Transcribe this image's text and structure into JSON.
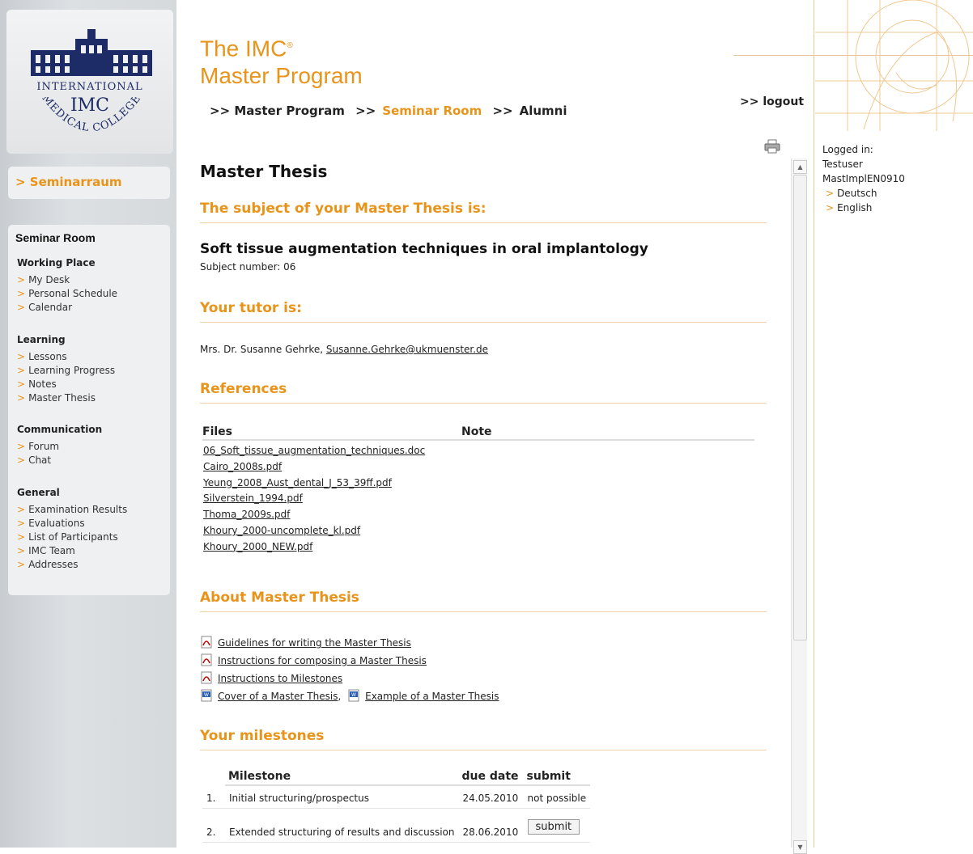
{
  "logo": {
    "line1": "INTERNATIONAL",
    "line2": "IMC",
    "line3": "MEDICAL COLLEGE"
  },
  "sidebar": {
    "section_link": "> Seminarraum",
    "menu_title": "Seminar Room",
    "groups": [
      {
        "title": "Working Place",
        "items": [
          "My Desk",
          "Personal Schedule",
          "Calendar"
        ]
      },
      {
        "title": "Learning",
        "items": [
          "Lessons",
          "Learning Progress",
          "Notes",
          "Master Thesis"
        ]
      },
      {
        "title": "Communication",
        "items": [
          "Forum",
          "Chat"
        ]
      },
      {
        "title": "General",
        "items": [
          "Examination Results",
          "Evaluations",
          "List of Participants",
          "IMC Team",
          "Addresses"
        ]
      }
    ]
  },
  "header": {
    "brand_line1": "The IMC",
    "brand_reg": "®",
    "brand_line2": "Master Program",
    "nav": [
      {
        "prefix": ">>",
        "label": "Master Program",
        "active": false
      },
      {
        "prefix": ">>",
        "label": "Seminar Room",
        "active": true
      },
      {
        "prefix": ">>",
        "label": "Alumni",
        "active": false
      }
    ],
    "logout": ">> logout"
  },
  "user": {
    "logged_in_label": "Logged in:",
    "name": "Testuser",
    "group": "MastImplEN0910",
    "languages": [
      "Deutsch",
      "English"
    ]
  },
  "main": {
    "title": "Master Thesis",
    "subject_heading": "The subject of your Master Thesis is:",
    "subject_title": "Soft tissue augmentation techniques in oral implantology",
    "subject_number": "Subject number: 06",
    "tutor_heading": "Your tutor is:",
    "tutor_name": "Mrs. Dr. Susanne Gehrke,",
    "tutor_email": "Susanne.Gehrke@ukmuenster.de",
    "references_heading": "References",
    "files_col": "Files",
    "note_col": "Note",
    "files": [
      "06_Soft_tissue_augmentation_techniques.doc",
      "Cairo_2008s.pdf",
      "Yeung_2008_Aust_dental_J_53_39ff.pdf",
      "Silverstein_1994.pdf",
      "Thoma_2009s.pdf",
      "Khoury_2000-uncomplete_kl.pdf",
      "Khoury_2000_NEW.pdf"
    ],
    "about_heading": "About Master Thesis",
    "about_links": {
      "guidelines": "Guidelines for writing the Master Thesis",
      "instructions_composing": "Instructions for composing a Master Thesis",
      "instructions_milestones": "Instructions to Milestones",
      "cover": "Cover of a Master Thesis",
      "comma": ",",
      "example": "Example of a Master Thesis"
    },
    "milestones_heading": "Your milestones",
    "milestone_cols": {
      "milestone": "Milestone",
      "due": "due date",
      "submit": "submit"
    },
    "milestones": [
      {
        "num": "1.",
        "name": "Initial structuring/prospectus",
        "due": "24.05.2010",
        "submit": "not possible"
      },
      {
        "num": "2.",
        "name": "Extended structuring of results and discussion",
        "due": "28.06.2010",
        "submit_button": "submit"
      }
    ]
  },
  "colors": {
    "accent": "#e8941a",
    "sidebar": "#d6d9dc",
    "panel": "#eef0f1"
  }
}
